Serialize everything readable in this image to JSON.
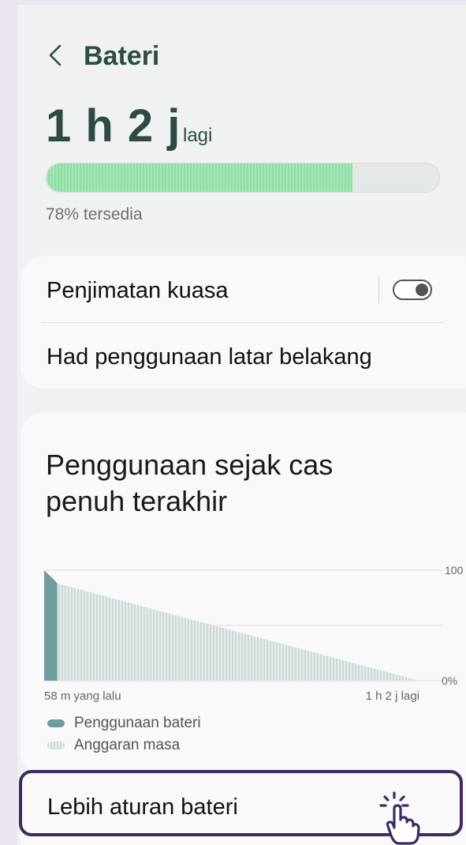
{
  "header": {
    "title": "Bateri"
  },
  "battery": {
    "time_left": "1 h 2 j",
    "time_suffix": "lagi",
    "level_percent": 78,
    "caption": "78% tersedia",
    "bar_color": "#a4e8b8"
  },
  "settings": {
    "power_saving_label": "Penjimatan kuasa",
    "power_saving_enabled": false,
    "background_limits_label": "Had penggunaan latar belakang"
  },
  "usage": {
    "title": "Penggunaan sejak cas penuh terakhir",
    "legend_usage": "Penggunaan bateri",
    "legend_estimate": "Anggaran masa"
  },
  "chart_data": {
    "type": "area",
    "y_tick_labels": [
      "100",
      "0%"
    ],
    "x_tick_labels": [
      "58 m yang lalu",
      "1 h 2 j lagi"
    ],
    "ylim": [
      0,
      100
    ],
    "grid": true,
    "legend_position": "bottom-left",
    "x": [
      0,
      0.0615,
      1
    ],
    "series": [
      {
        "name": "Penggunaan bateri",
        "color": "#6f9e9c",
        "x": [
          0,
          0.012,
          0.025,
          0.035
        ],
        "values": [
          100,
          96,
          92,
          88
        ]
      },
      {
        "name": "Anggaran masa",
        "color": "#cbd9d8",
        "x": [
          0.035,
          1
        ],
        "values": [
          88,
          0
        ]
      }
    ]
  },
  "more": {
    "label": "Lebih aturan bateri"
  },
  "icons": {
    "back": "chevron-left-icon",
    "tap": "tap-hand-icon"
  }
}
